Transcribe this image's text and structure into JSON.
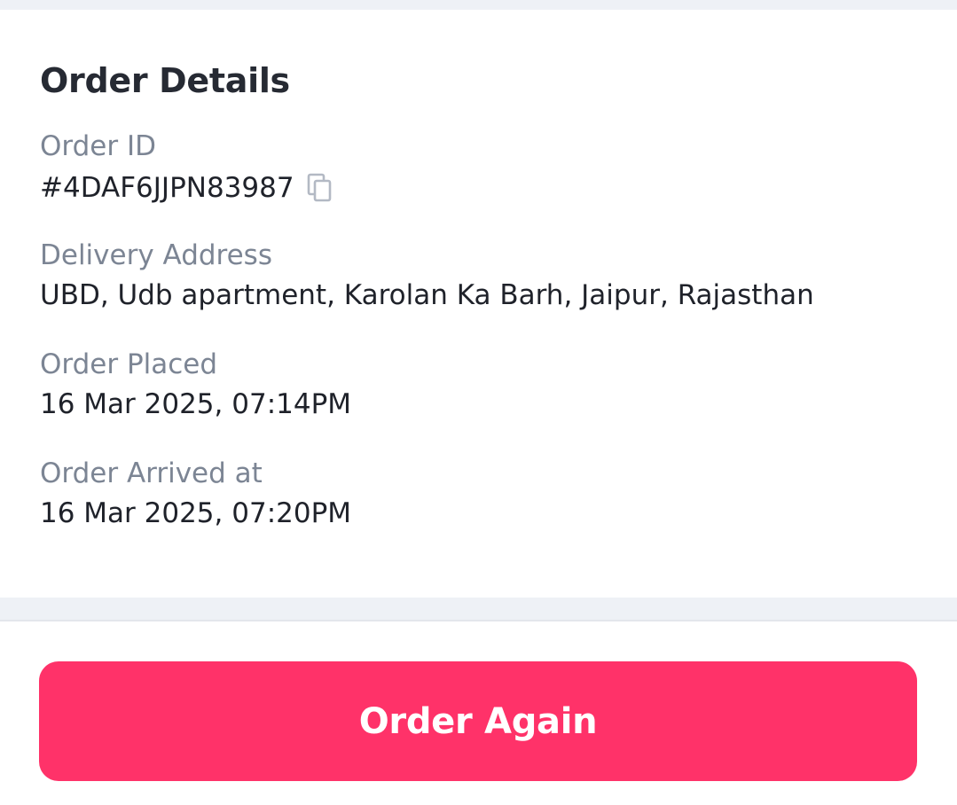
{
  "order_details": {
    "title": "Order Details",
    "order_id": {
      "label": "Order ID",
      "value": "#4DAF6JJPN83987",
      "copy_icon": "copy-icon"
    },
    "delivery_address": {
      "label": "Delivery Address",
      "value": "UBD, Udb apartment, Karolan Ka Barh, Jaipur, Rajasthan"
    },
    "order_placed": {
      "label": "Order Placed",
      "value": "16 Mar 2025, 07:14PM"
    },
    "order_arrived": {
      "label": "Order Arrived at",
      "value": "16 Mar 2025, 07:20PM"
    }
  },
  "actions": {
    "order_again_label": "Order Again"
  },
  "colors": {
    "accent": "#ff3269",
    "background_band": "#eef1f6",
    "label_text": "#7c8594",
    "value_text": "#1f222a"
  }
}
